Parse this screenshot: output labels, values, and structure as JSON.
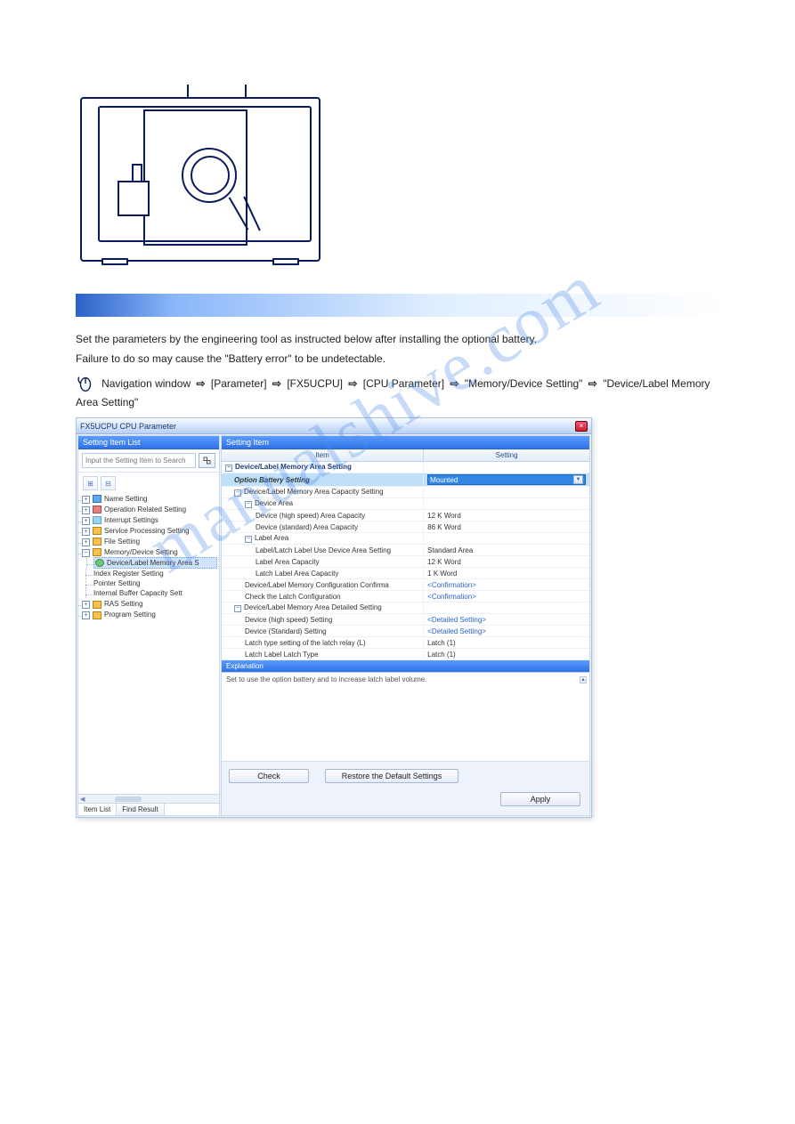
{
  "watermark": "manualshive.com",
  "body_text1": "Set the parameters by the engineering tool as instructed below after installing the optional battery.",
  "body_text2": "Failure to do so may cause the \"Battery error\" to be undetectable.",
  "nav_path_parts": [
    "Navigation window",
    "[Parameter]",
    "[FX5UCPU]",
    "[CPU Parameter]",
    "\"Memory/Device Setting\"",
    "\"Device/Label Memory Area Setting\""
  ],
  "dialog": {
    "title": "FX5UCPU CPU Parameter",
    "close_icon": "×",
    "left": {
      "head": "Setting Item List",
      "search_placeholder": "Input the Setting Item to Search",
      "toolbar": [
        "⊞",
        "⊟"
      ],
      "tree": [
        {
          "icon": "blue",
          "label": "Name Setting",
          "exp": "+"
        },
        {
          "icon": "red",
          "label": "Operation Related Setting",
          "exp": "+"
        },
        {
          "icon": "sky",
          "label": "Interrupt Settings",
          "exp": "+"
        },
        {
          "icon": "yellow",
          "label": "Service Processing Setting",
          "exp": "+"
        },
        {
          "icon": "yellow",
          "label": "File Setting",
          "exp": "+"
        },
        {
          "icon": "yellow",
          "label": "Memory/Device Setting",
          "exp": "-",
          "children": [
            {
              "icon": "green",
              "label": "Device/Label Memory Area S",
              "selected": true
            },
            {
              "label": "Index Register Setting"
            },
            {
              "label": "Pointer Setting"
            },
            {
              "label": "Internal Buffer Capacity Sett"
            }
          ]
        },
        {
          "icon": "yellow",
          "label": "RAS Setting",
          "exp": "+"
        },
        {
          "icon": "yellow",
          "label": "Program Setting",
          "exp": "+"
        }
      ],
      "tabs": [
        "Item List",
        "Find Result"
      ]
    },
    "right": {
      "head": "Setting Item",
      "columns": [
        "Item",
        "Setting"
      ],
      "rows": [
        {
          "type": "group",
          "l": "Device/Label Memory Area Setting",
          "r": ""
        },
        {
          "type": "hl",
          "l_indent": 1,
          "l": "Option Battery Setting",
          "italic": true,
          "r_dropdown": "Mounted"
        },
        {
          "type": "sub",
          "l_indent": 1,
          "l": "Device/Label Memory Area Capacity Setting",
          "box": "-",
          "r": ""
        },
        {
          "type": "sub",
          "l_indent": 2,
          "l": "Device Area",
          "box": "-",
          "r": ""
        },
        {
          "l_indent": 3,
          "l": "Device (high speed) Area Capacity",
          "r": "12 K Word"
        },
        {
          "l_indent": 3,
          "l": "Device (standard) Area Capacity",
          "r": "86 K Word"
        },
        {
          "type": "sub",
          "l_indent": 2,
          "l": "Label Area",
          "box": "-",
          "r": ""
        },
        {
          "l_indent": 3,
          "l": "Label/Latch Label Use Device Area Setting",
          "r": "Standard Area"
        },
        {
          "l_indent": 3,
          "l": "Label Area Capacity",
          "r": "12 K Word"
        },
        {
          "l_indent": 3,
          "l": "Latch Label Area Capacity",
          "r": "1 K Word"
        },
        {
          "l_indent": 2,
          "l": "Device/Label Memory Configuration Confirma",
          "r": "<Confirmation>",
          "link": true
        },
        {
          "l_indent": 2,
          "l": "Check the Latch Configuration",
          "r": "<Confirmation>",
          "link": true
        },
        {
          "type": "sub",
          "l_indent": 1,
          "l": "Device/Label Memory Area Detailed Setting",
          "box": "-",
          "r": ""
        },
        {
          "l_indent": 2,
          "l": "Device (high speed) Setting",
          "r": "<Detailed Setting>",
          "link": true
        },
        {
          "l_indent": 2,
          "l": "Device (Standard) Setting",
          "r": "<Detailed Setting>",
          "link": true
        },
        {
          "l_indent": 2,
          "l": "Latch type setting of the latch relay (L)",
          "r": "Latch (1)"
        },
        {
          "l_indent": 2,
          "l": "Latch Label Latch Type",
          "r": "Latch (1)"
        }
      ],
      "explain_head": "Explanation",
      "explain_body": "Set to use the option battery and to increase latch label volume.",
      "buttons": {
        "check": "Check",
        "restore": "Restore the Default Settings",
        "apply": "Apply"
      }
    }
  }
}
